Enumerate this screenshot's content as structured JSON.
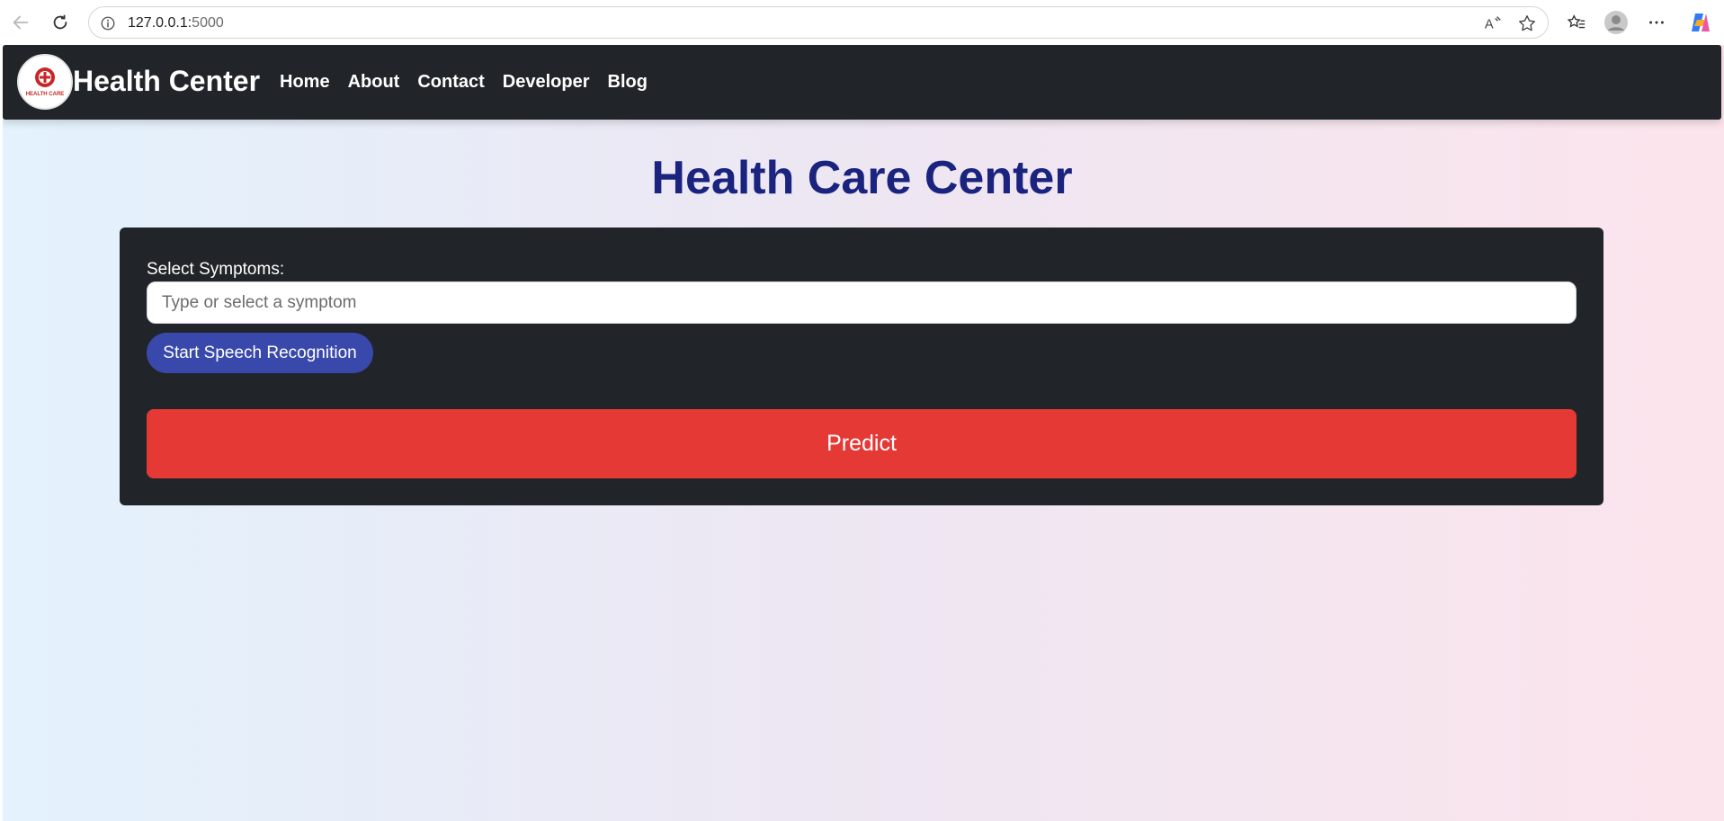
{
  "browser": {
    "url_host": "127.0.0.1:",
    "url_port": "5000"
  },
  "nav": {
    "brand": "Health Center",
    "logo_text": "HEALTH CARE",
    "links": [
      "Home",
      "About",
      "Contact",
      "Developer",
      "Blog"
    ]
  },
  "page": {
    "title": "Health Care Center"
  },
  "form": {
    "label": "Select Symptoms:",
    "input_placeholder": "Type or select a symptom",
    "input_value": "",
    "speech_button": "Start Speech Recognition",
    "predict_button": "Predict"
  },
  "colors": {
    "navbar": "#212529",
    "title": "#1a237e",
    "speech_button": "#3949ab",
    "predict_button": "#e53935"
  }
}
